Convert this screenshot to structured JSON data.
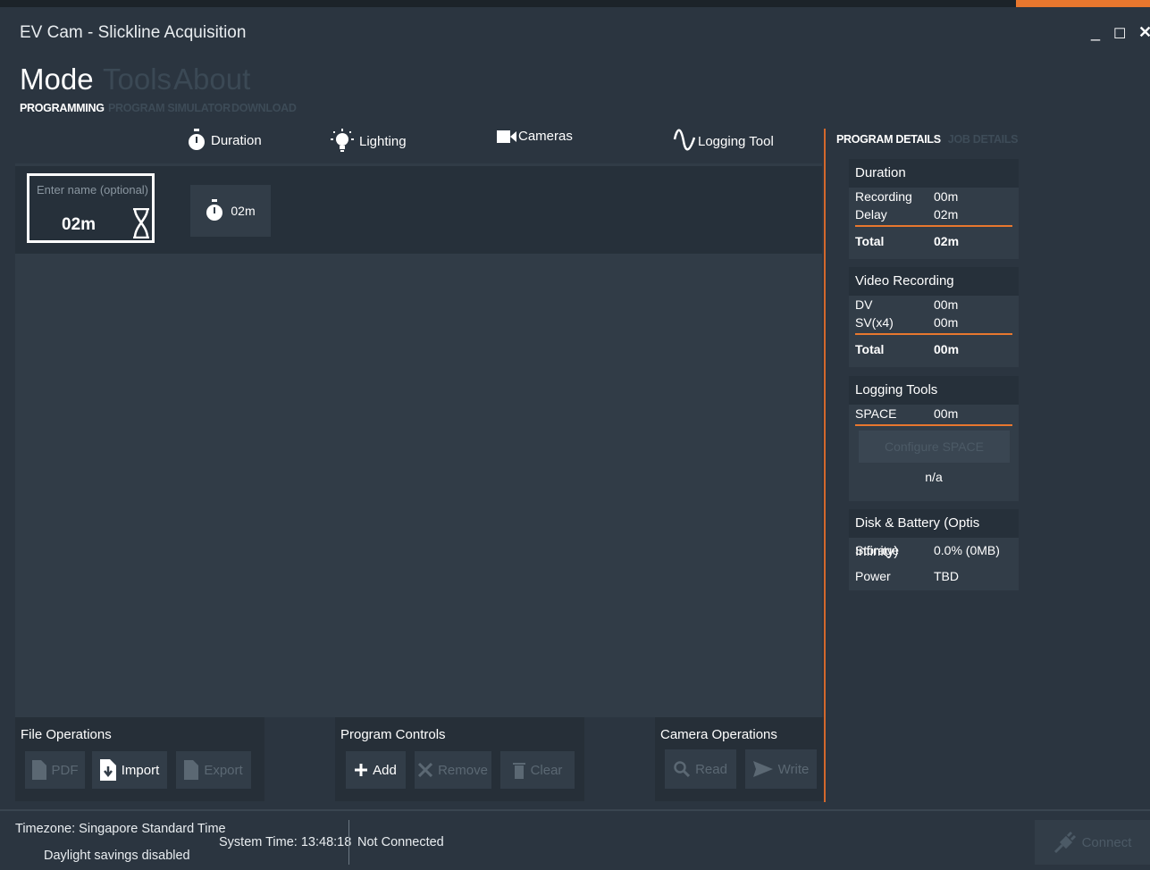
{
  "window": {
    "title": "EV Cam - Slickline Acquisition",
    "controls": {
      "minimize": "_",
      "maximize": "☐",
      "close": "✕"
    }
  },
  "menu": {
    "items": [
      "Mode",
      "Tools",
      "About"
    ],
    "active": "Mode"
  },
  "submenu": {
    "items": [
      "PROGRAMMING",
      "PROGRAM SIMULATOR",
      "DOWNLOAD"
    ],
    "active": "PROGRAMMING"
  },
  "toolbar": {
    "tabs": [
      "Duration",
      "Lighting",
      "Cameras",
      "Logging Tool"
    ]
  },
  "program": {
    "name_placeholder": "Enter name (optional)",
    "name_value": "02m",
    "step_duration": "02m"
  },
  "right_panel": {
    "tabs": [
      "PROGRAM DETAILS",
      "JOB DETAILS"
    ],
    "duration": {
      "title": "Duration",
      "rows": [
        {
          "label": "Recording",
          "value": "00m"
        },
        {
          "label": "Delay",
          "value": "02m"
        }
      ],
      "total_label": "Total",
      "total_value": "02m"
    },
    "video": {
      "title": "Video Recording",
      "rows": [
        {
          "label": "DV",
          "value": "00m"
        },
        {
          "label": "SV(x4)",
          "value": "00m"
        }
      ],
      "total_label": "Total",
      "total_value": "00m"
    },
    "logging": {
      "title": "Logging Tools",
      "space_label": "SPACE",
      "space_value": "00m",
      "configure_label": "Configure SPACE",
      "na": "n/a"
    },
    "disk": {
      "title": "Disk & Battery (Optis Infinity)",
      "storage_label": "Storage",
      "storage_value": "0.0% (0MB)",
      "power_label": "Power",
      "power_value": "TBD"
    }
  },
  "file_ops": {
    "title": "File Operations",
    "pdf": "PDF",
    "import": "Import",
    "export": "Export"
  },
  "program_controls": {
    "title": "Program Controls",
    "add": "Add",
    "remove": "Remove",
    "clear": "Clear"
  },
  "camera_ops": {
    "title": "Camera Operations",
    "read": "Read",
    "write": "Write"
  },
  "status": {
    "timezone": "Timezone: Singapore Standard Time",
    "dst": "Daylight savings disabled",
    "system_time": "System Time: 13:48:18",
    "connection": "Not Connected",
    "connect_label": "Connect"
  },
  "colors": {
    "accent": "#e8772e",
    "background": "#2b3540",
    "panel": "#323d48",
    "dark": "#26303a"
  }
}
